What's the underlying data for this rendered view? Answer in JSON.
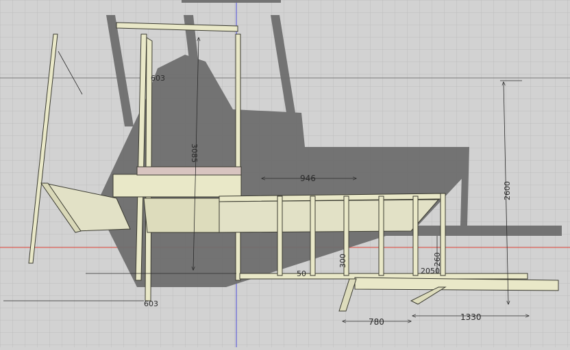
{
  "viewport": {
    "background": "#d2d2d2",
    "grid_color": "#bdbdbd",
    "axis_x_color": "#e0453a",
    "axis_y_color": "#4b4bd8",
    "shadow_color": "#6e6e6e",
    "frame_fill": "#e9e8c8",
    "frame_edge": "#3a3a30",
    "dimension_color": "#2a2a2a"
  },
  "dimensions": {
    "d_603_top": "603",
    "d_3085": "3085",
    "d_946": "946",
    "d_2600": "2600",
    "d_300": "300",
    "d_50": "50",
    "d_2050": "2050",
    "d_260": "260",
    "d_603_bottom": "603",
    "d_780": "780",
    "d_1330": "1330"
  }
}
